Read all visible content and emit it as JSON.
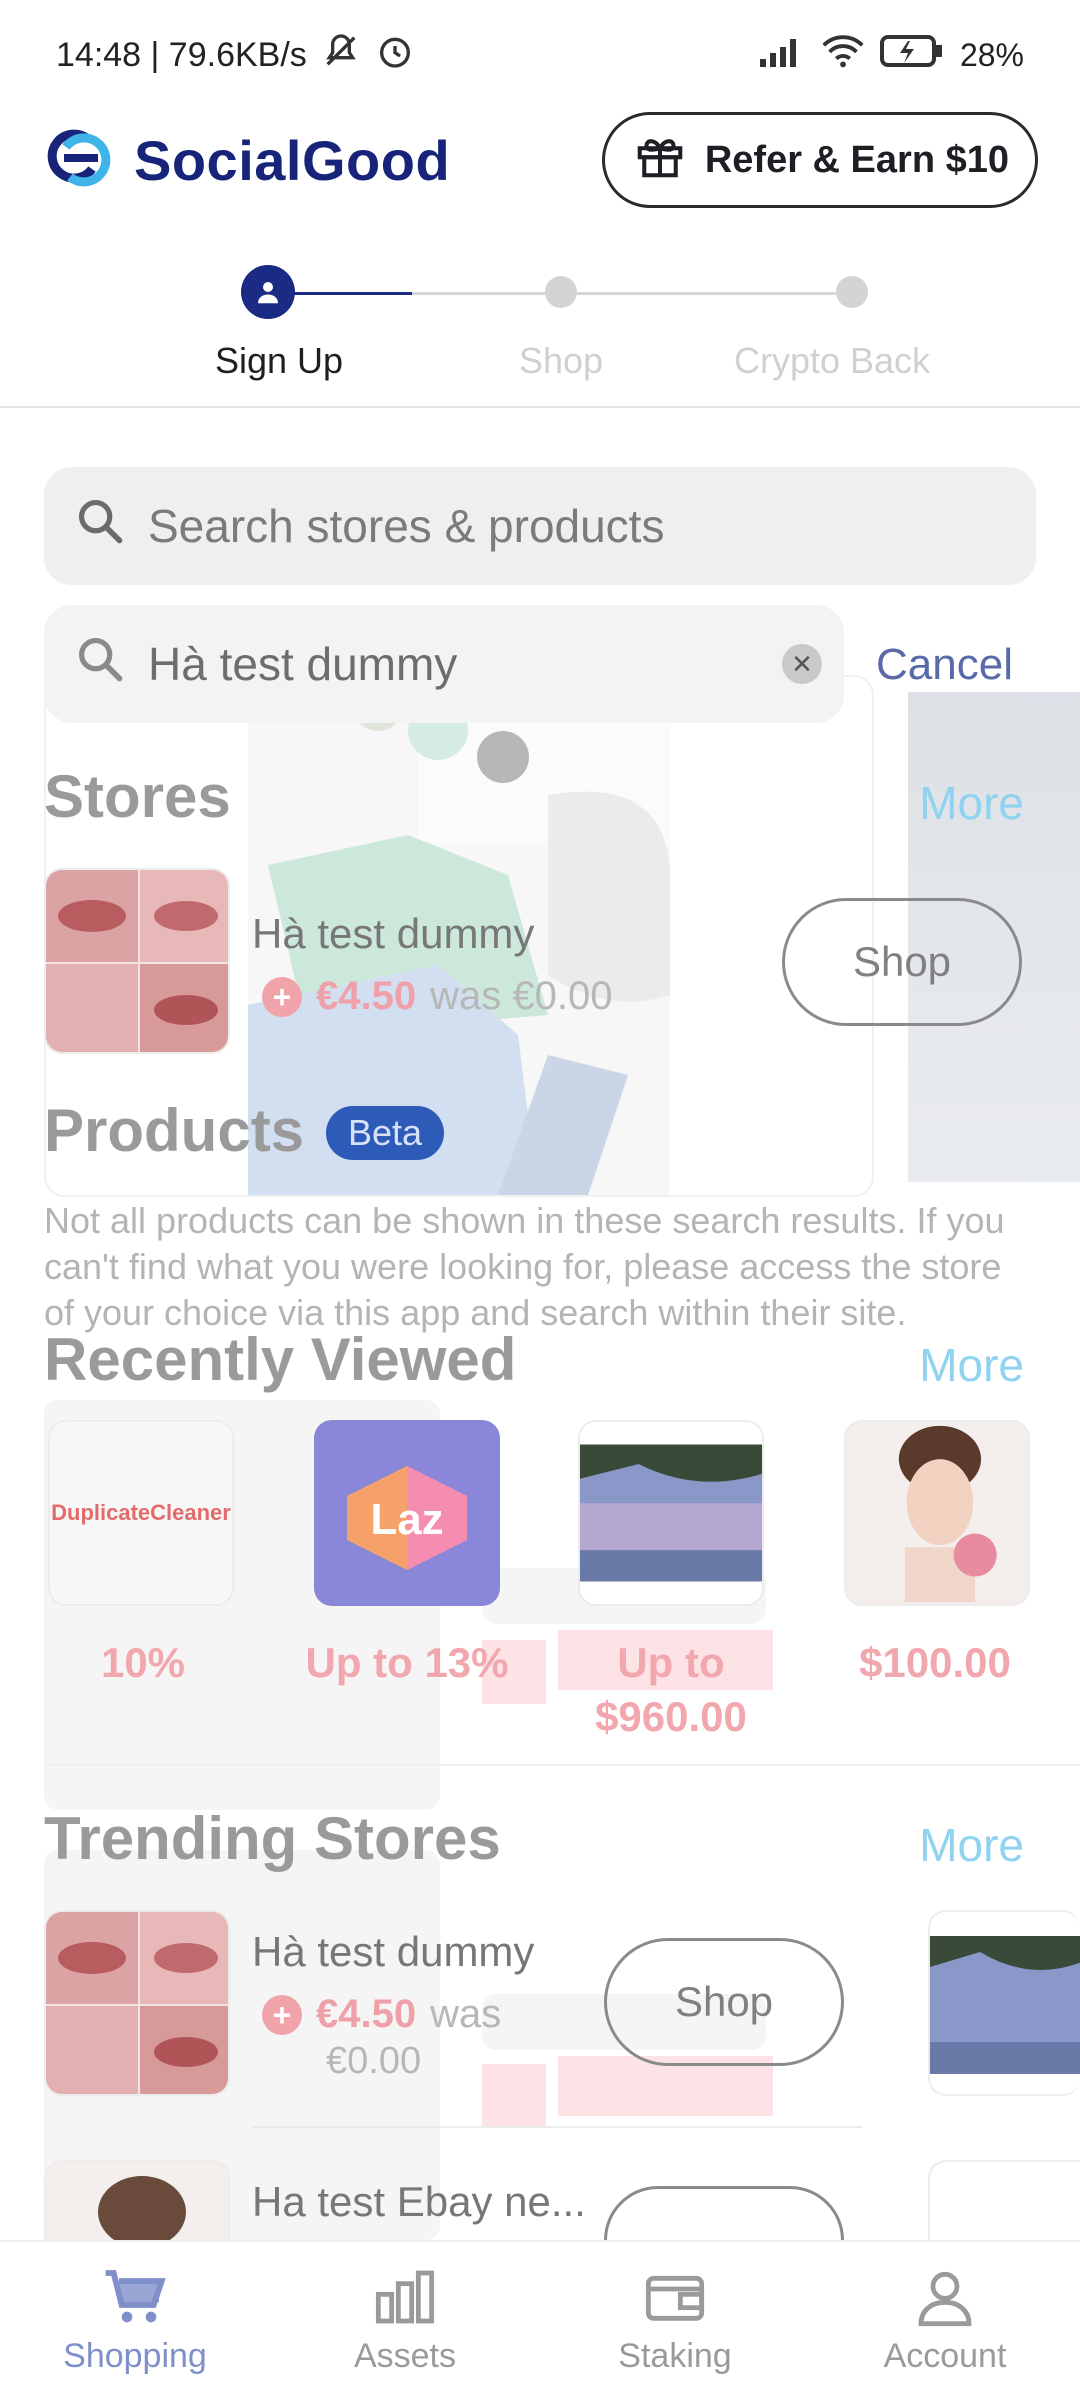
{
  "status_bar": {
    "time": "14:48 | 79.6KB/s",
    "battery": "28%"
  },
  "header": {
    "brand": "SocialGood",
    "refer_button": "Refer & Earn $10"
  },
  "stepper": {
    "steps": [
      "Sign Up",
      "Shop",
      "Crypto Back"
    ],
    "active_index": 0
  },
  "search": {
    "placeholder": "Search stores & products",
    "query": "Hà test dummy",
    "cancel": "Cancel"
  },
  "stores": {
    "title": "Stores",
    "more": "More",
    "item": {
      "name": "Hà test dummy",
      "price": "€4.50",
      "was": "was €0.00",
      "shop": "Shop"
    }
  },
  "products": {
    "title": "Products",
    "badge": "Beta",
    "disclaimer": "Not all products can be shown in these search results. If you can't find what you were looking for, please access the store of your choice via this app and search within their site."
  },
  "recently_viewed": {
    "title": "Recently Viewed",
    "more": "More",
    "items": [
      {
        "thumb_text": "DuplicateCleaner",
        "label": "10%"
      },
      {
        "thumb_text": "Laz",
        "label": "Up to 13%"
      },
      {
        "thumb_text": "",
        "label": "Up to $960.00"
      },
      {
        "thumb_text": "",
        "label": "$100.00"
      }
    ]
  },
  "trending": {
    "title": "Trending Stores",
    "more": "More",
    "items": [
      {
        "name": "Hà test dummy",
        "price": "€4.50",
        "was": "was",
        "was_value": "€0.00",
        "shop": "Shop"
      },
      {
        "name": "Ha test Ebay ne..."
      }
    ]
  },
  "bottom_nav": {
    "items": [
      "Shopping",
      "Assets",
      "Staking",
      "Account"
    ],
    "active_index": 0
  },
  "colors": {
    "brand_navy": "#17247a",
    "accent_blue": "#8fd3f0",
    "price_red": "#f0a0a8",
    "beta_blue": "#2e5bb8"
  }
}
